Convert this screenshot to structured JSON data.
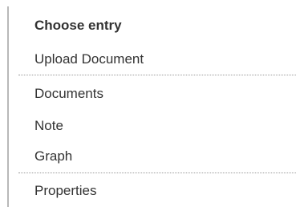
{
  "menu": {
    "heading": "Choose entry",
    "upload_label": "Upload Document",
    "items": [
      {
        "label": "Documents"
      },
      {
        "label": "Note"
      },
      {
        "label": "Graph"
      }
    ],
    "properties_label": "Properties"
  }
}
